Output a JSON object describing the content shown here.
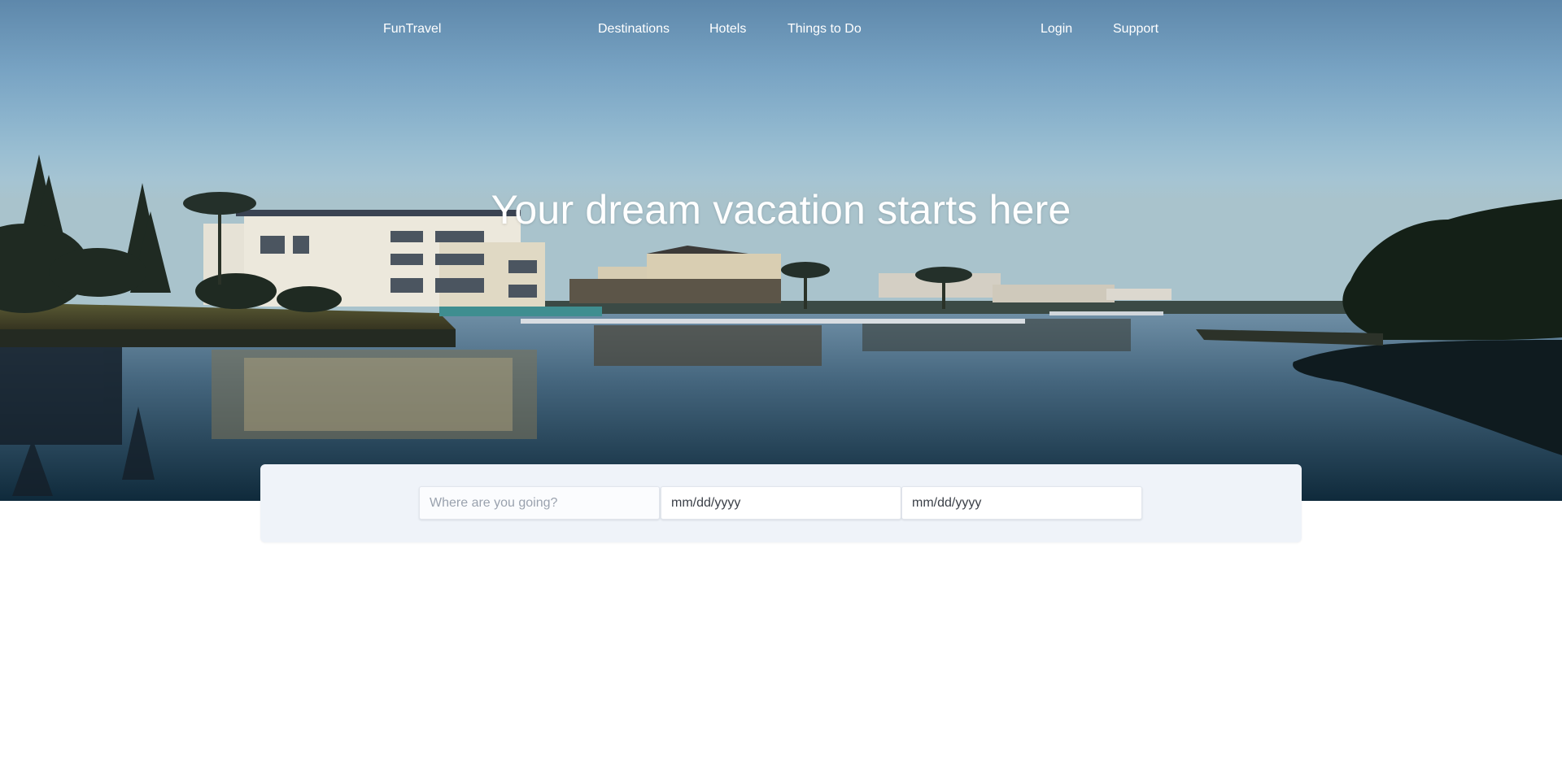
{
  "nav": {
    "brand": "FunTravel",
    "links": [
      "Destinations",
      "Hotels",
      "Things to Do"
    ],
    "account": [
      "Login",
      "Support"
    ]
  },
  "hero": {
    "title": "Your dream vacation starts here",
    "image": "canal-waterfront-houses-at-dusk"
  },
  "search": {
    "destination_placeholder": "Where are you going?",
    "checkin_value": "mm/dd/yyyy",
    "checkout_value": "mm/dd/yyyy"
  },
  "colors": {
    "sky_top": "#5e88ab",
    "panel_bg": "#eff3f9",
    "text_light": "#ffffff"
  }
}
